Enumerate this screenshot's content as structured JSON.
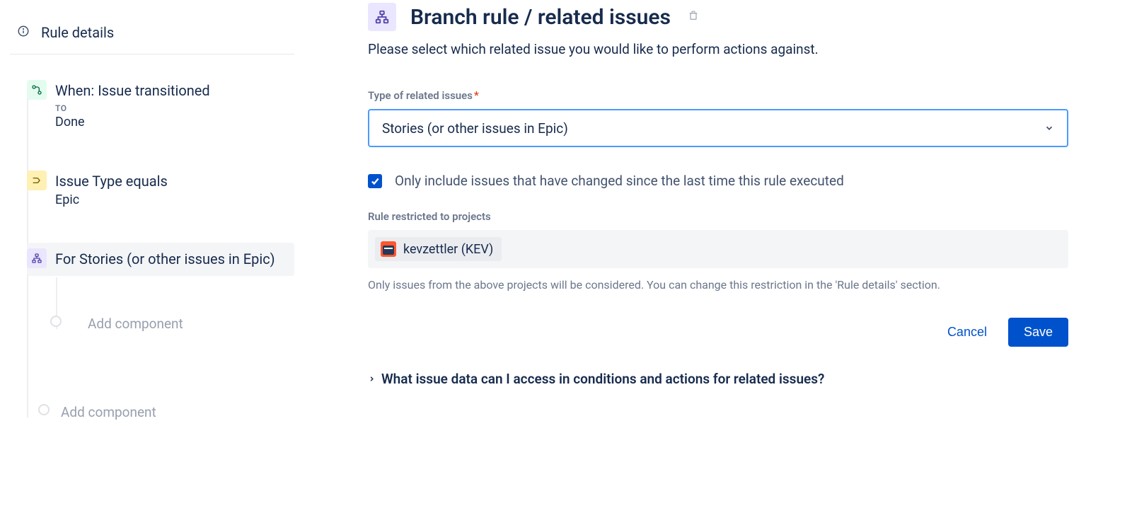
{
  "sidebar": {
    "rule_details": "Rule details",
    "trigger": {
      "title": "When: Issue transitioned",
      "to_label": "TO",
      "to_value": "Done"
    },
    "condition": {
      "title": "Issue Type equals",
      "value": "Epic"
    },
    "branch": {
      "title": "For Stories (or other issues in Epic)"
    },
    "add_inner": "Add component",
    "add_outer": "Add component"
  },
  "main": {
    "title": "Branch rule / related issues",
    "description": "Please select which related issue you would like to perform actions against.",
    "type_label": "Type of related issues",
    "type_value": "Stories (or other issues in Epic)",
    "checkbox_label": "Only include issues that have changed since the last time this rule executed",
    "restrict_label": "Rule restricted to projects",
    "project_name": "kevzettler (KEV)",
    "helper": "Only issues from the above projects will be considered. You can change this restriction in the 'Rule details' section.",
    "cancel": "Cancel",
    "save": "Save",
    "expand": "What issue data can I access in conditions and actions for related issues?"
  }
}
